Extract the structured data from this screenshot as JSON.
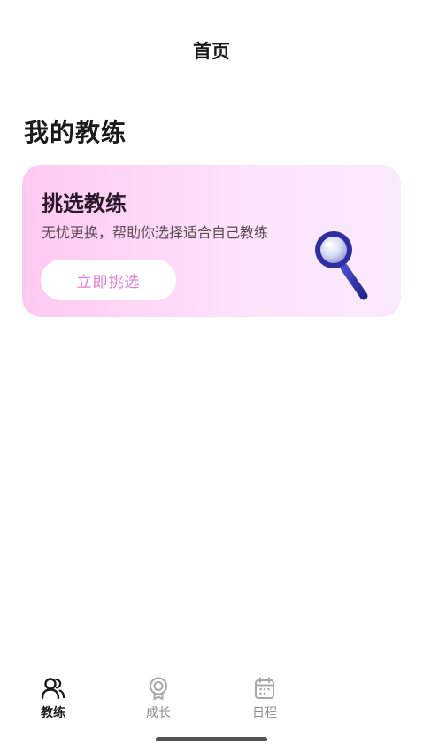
{
  "header": {
    "title": "首页"
  },
  "main": {
    "section_title": "我的教练",
    "card": {
      "title": "挑选教练",
      "subtitle": "无忧更换，帮助你选择适合自己教练",
      "button_label": "立即挑选",
      "icon": "magnifier-icon"
    }
  },
  "tab_bar": {
    "tabs": [
      {
        "label": "教练",
        "icon": "people-icon",
        "active": true
      },
      {
        "label": "成长",
        "icon": "medal-icon",
        "active": false
      },
      {
        "label": "日程",
        "icon": "calendar-icon",
        "active": false
      }
    ]
  },
  "colors": {
    "card_gradient_start": "#fec9f1",
    "card_gradient_end": "#f9eafc",
    "button_text": "#e67bd8",
    "magnifier": "#3b3bb8"
  }
}
